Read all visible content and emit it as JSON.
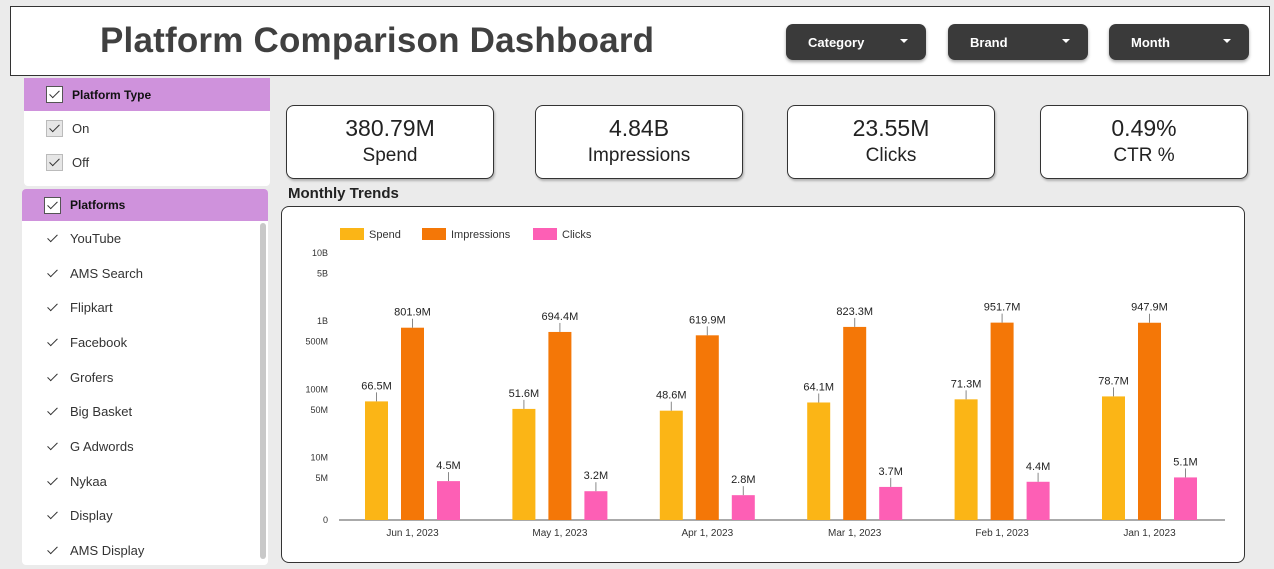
{
  "header": {
    "title": "Platform Comparison Dashboard",
    "filters": [
      {
        "label": "Category"
      },
      {
        "label": "Brand"
      },
      {
        "label": "Month"
      }
    ]
  },
  "platform_type": {
    "header": "Platform Type",
    "items": [
      {
        "label": "On"
      },
      {
        "label": "Off"
      }
    ]
  },
  "platforms": {
    "header": "Platforms",
    "items": [
      {
        "label": "YouTube"
      },
      {
        "label": "AMS Search"
      },
      {
        "label": "Flipkart"
      },
      {
        "label": "Facebook"
      },
      {
        "label": "Grofers"
      },
      {
        "label": "Big Basket"
      },
      {
        "label": "G Adwords"
      },
      {
        "label": "Nykaa"
      },
      {
        "label": "Display"
      },
      {
        "label": "AMS Display"
      }
    ]
  },
  "kpis": [
    {
      "value": "380.79M",
      "label": "Spend"
    },
    {
      "value": "4.84B",
      "label": "Impressions"
    },
    {
      "value": "23.55M",
      "label": "Clicks"
    },
    {
      "value": "0.49%",
      "label": "CTR %"
    }
  ],
  "section_title": "Monthly Trends",
  "chart_data": {
    "type": "bar",
    "yscale": "log",
    "ytick_labels": [
      "0",
      "5M",
      "10M",
      "50M",
      "100M",
      "500M",
      "1B",
      "5B",
      "10B"
    ],
    "ytick_values": [
      0,
      5000000,
      10000000,
      50000000,
      100000000,
      500000000,
      1000000000,
      5000000000,
      10000000000
    ],
    "categories": [
      "Jun 1, 2023",
      "May 1, 2023",
      "Apr 1, 2023",
      "Mar 1, 2023",
      "Feb 1, 2023",
      "Jan 1, 2023"
    ],
    "series": [
      {
        "name": "Spend",
        "color": "#fbb516",
        "values": [
          66500000,
          51600000,
          48600000,
          64100000,
          71300000,
          78700000
        ],
        "labels": [
          "66.5M",
          "51.6M",
          "48.6M",
          "64.1M",
          "71.3M",
          "78.7M"
        ]
      },
      {
        "name": "Impressions",
        "color": "#f47707",
        "values": [
          801900000,
          694400000,
          619900000,
          823300000,
          951700000,
          947900000
        ],
        "labels": [
          "801.9M",
          "694.4M",
          "619.9M",
          "823.3M",
          "951.7M",
          "947.9M"
        ]
      },
      {
        "name": "Clicks",
        "color": "#fd5fb5",
        "values": [
          4500000,
          3200000,
          2800000,
          3700000,
          4400000,
          5100000
        ],
        "labels": [
          "4.5M",
          "3.2M",
          "2.8M",
          "3.7M",
          "4.4M",
          "5.1M"
        ]
      }
    ],
    "legend": "top-left"
  }
}
